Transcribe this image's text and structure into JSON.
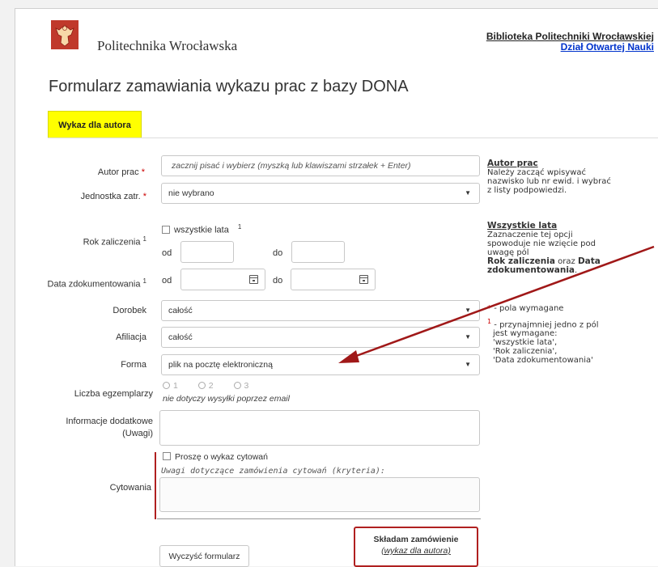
{
  "header": {
    "university": "Politechnika Wrocławska",
    "library_line1": "Biblioteka Politechniki Wrocławskiej",
    "library_line2": "Dział Otwartej Nauki"
  },
  "title": "Formularz zamawiania wykazu prac z bazy DONA",
  "tab_label": "Wykaz dla autora",
  "form": {
    "author_label": "Autor prac",
    "author_placeholder": "zacznij pisać i wybierz (myszką lub klawiszami strzałek + Enter)",
    "unit_label": "Jednostka zatr.",
    "unit_value": "nie wybrano",
    "all_years_label": "wszystkie lata",
    "year_label": "Rok zaliczenia",
    "from_label": "od",
    "to_label": "do",
    "date_label": "Data zdokumentowania",
    "output_label": "Dorobek",
    "output_value": "całość",
    "affiliation_label": "Afiliacja",
    "affiliation_value": "całość",
    "form_label": "Forma",
    "form_value": "plik na pocztę elektroniczną",
    "copies_label": "Liczba egzemplarzy",
    "copies_options": [
      "1",
      "2",
      "3"
    ],
    "copies_note": "nie dotyczy wysyłki poprzez email",
    "info_label_1": "Informacje dodatkowe",
    "info_label_2": "(Uwagi)",
    "citations_label": "Cytowania",
    "citations_checkbox": "Proszę o wykaz cytowań",
    "citations_note": "Uwagi dotyczące zamówienia cytowań (kryteria):",
    "required_mark": "*",
    "one_mark": "1"
  },
  "help": {
    "author_title": "Autor prac",
    "author_text": [
      "Należy zacząć wpisywać",
      "nazwisko lub nr ewid. i wybrać",
      "z listy podpowiedzi."
    ],
    "years_title": "Wszystkie lata",
    "years_text": [
      "Zaznaczenie tej opcji",
      "spowoduje nie wzięcie pod",
      "uwagę pól"
    ],
    "years_bold_1": "Rok zaliczenia",
    "years_join": "oraz",
    "years_bold_2": "Data",
    "years_bold_3": "zdokumentowania",
    "years_end": ".",
    "note_required": "- pola wymagane",
    "note_one": [
      "- przynajmniej jedno z pól",
      "jest wymagane:",
      "'wszystkie lata',",
      "'Rok zaliczenia',",
      "'Data zdokumentowania'"
    ]
  },
  "buttons": {
    "clear": "Wyczyść formularz",
    "order_1": "Składam zamówienie",
    "order_2": "(wykaz dla autora)"
  },
  "colors": {
    "tab_bg": "#ffff00",
    "annotation_red": "#b02020",
    "link_blue": "#0033cc",
    "required_red": "#cc0000"
  },
  "icons": [
    "crest-logo",
    "calendar-icon",
    "chevron-down-icon",
    "annotation-arrow"
  ]
}
